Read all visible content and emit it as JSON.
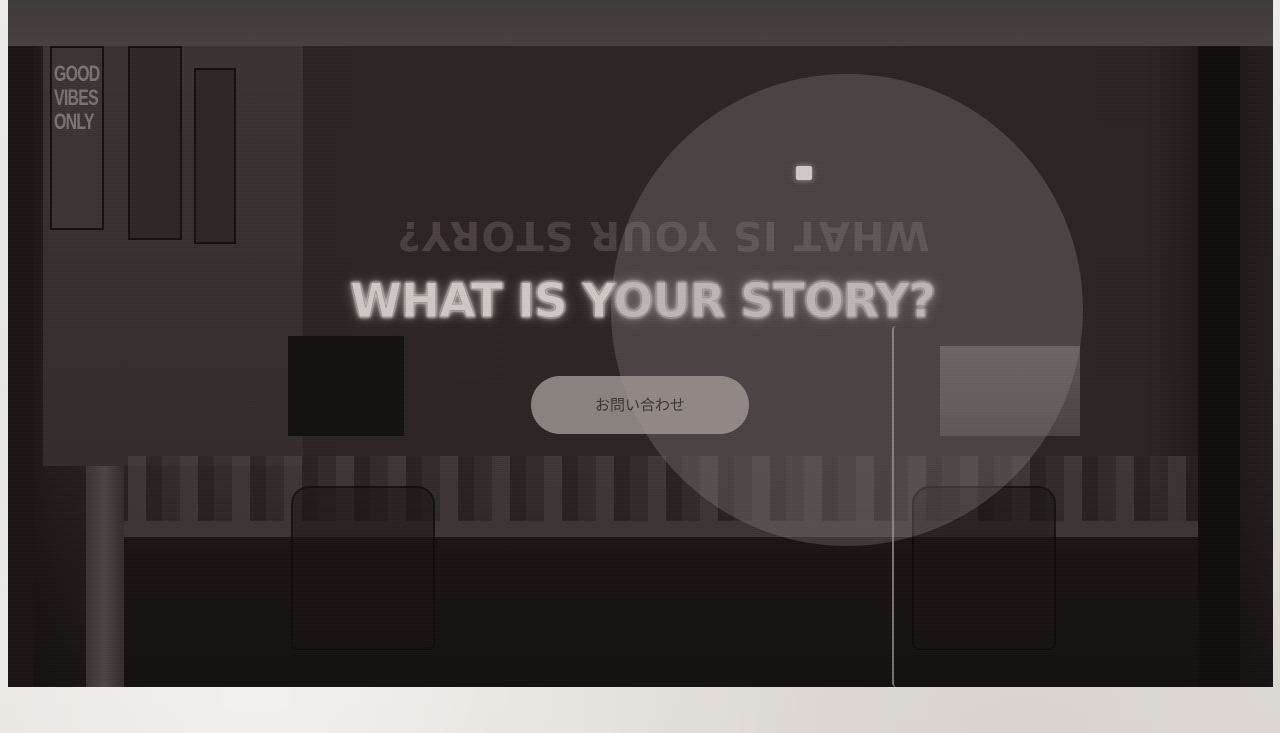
{
  "hero": {
    "headline": "WHAT IS YOUR STORY?",
    "reflection": "WHAT IS YOUR STORY?",
    "poster_text": "GOOD\nVIBES\nONLY",
    "cta_label": "お問い合わせ"
  },
  "colors": {
    "top_band": "#433f3c",
    "hero_overlay": "#2b2524",
    "circle_overlay": "rgba(150,140,138,0.30)",
    "button_bg": "rgba(165,156,153,0.78)",
    "button_text": "#3c3533",
    "page_background": "#e9e6e0"
  }
}
